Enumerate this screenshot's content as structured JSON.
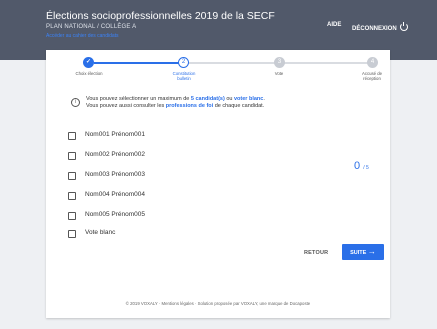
{
  "header": {
    "title": "Élections socioprofessionnelles 2019 de la SECF",
    "subtitle": "PLAN NATIONAL / COLLÈGE A",
    "sublink": "Accéder au cahier des candidats",
    "aide": "AIDE",
    "deconnexion": "DÉCONNEXION"
  },
  "steps": [
    {
      "label": "Choix élection",
      "state": "done",
      "number": ""
    },
    {
      "label": "Constitution bulletin",
      "state": "active",
      "number": "2"
    },
    {
      "label": "Vote",
      "state": "pending",
      "number": "3"
    },
    {
      "label": "Accusé de réception",
      "state": "pending",
      "number": "4"
    }
  ],
  "info": {
    "line1_prefix": "Vous pouvez sélectionner un maximum de ",
    "line1_count": "5 candidat(s)",
    "line1_mid": " ou ",
    "line1_blank": "voter blanc",
    "line1_suffix": ".",
    "line2_prefix": "Vous pouvez aussi consulter les ",
    "line2_link": "professions de foi",
    "line2_suffix": " de chaque candidat."
  },
  "candidates": [
    "Nom001 Prénom001",
    "Nom002 Prénom002",
    "Nom003 Prénom003",
    "Nom004 Prénom004",
    "Nom005 Prénom005",
    "Vote blanc"
  ],
  "counter": {
    "selected": "0",
    "max": "/ 5"
  },
  "buttons": {
    "retour": "RETOUR",
    "suite": "SUITE"
  },
  "footer": "© 2019 VOXALY · Mentions légales · Solution proposée par VOXALY, une marque de Docaposte",
  "colors": {
    "header": "#51596a",
    "accent": "#2a6fe8",
    "background": "#eef0f3"
  }
}
